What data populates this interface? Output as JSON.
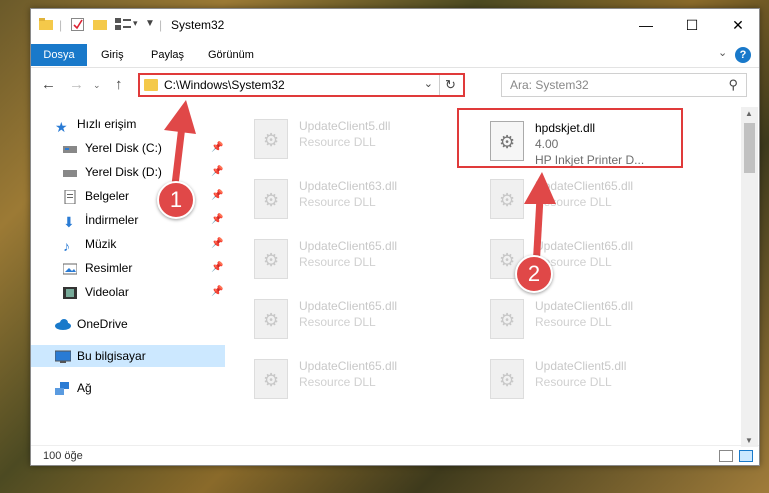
{
  "window": {
    "title": "System32",
    "minimize": "—",
    "maximize": "☐",
    "close": "✕"
  },
  "ribbon": {
    "tabs": [
      "Dosya",
      "Giriş",
      "Paylaş",
      "Görünüm"
    ],
    "help": "?"
  },
  "nav": {
    "address": "C:\\Windows\\System32",
    "search_placeholder": "Ara: System32"
  },
  "sidebar": {
    "items": [
      {
        "label": "Hızlı erişim",
        "icon": "star-icon"
      },
      {
        "label": "Yerel Disk (C:)",
        "icon": "drive-icon"
      },
      {
        "label": "Yerel Disk (D:)",
        "icon": "drive-icon"
      },
      {
        "label": "Belgeler",
        "icon": "documents-icon"
      },
      {
        "label": "İndirmeler",
        "icon": "download-icon"
      },
      {
        "label": "Müzik",
        "icon": "music-icon"
      },
      {
        "label": "Resimler",
        "icon": "pictures-icon"
      },
      {
        "label": "Videolar",
        "icon": "videos-icon"
      },
      {
        "label": "OneDrive",
        "icon": "cloud-icon"
      },
      {
        "label": "Bu bilgisayar",
        "icon": "computer-icon"
      },
      {
        "label": "Ağ",
        "icon": "network-icon"
      }
    ]
  },
  "files": {
    "left": [
      {
        "name": "UpdateClient5.dll",
        "type": "Resource DLL"
      },
      {
        "name": "UpdateClient63.dll",
        "type": "Resource DLL"
      },
      {
        "name": "UpdateClient65.dll",
        "type": "Resource DLL"
      },
      {
        "name": "UpdateClient65.dll",
        "type": "Resource DLL"
      },
      {
        "name": "UpdateClient65.dll",
        "type": "Resource DLL"
      }
    ],
    "right": [
      {
        "name": "hpdskjet.dll",
        "version": "4.00",
        "type": "HP Inkjet Printer D..."
      },
      {
        "name": "UpdateClient65.dll",
        "type": "Resource DLL"
      },
      {
        "name": "UpdateClient65.dll",
        "type": "Resource DLL"
      },
      {
        "name": "UpdateClient65.dll",
        "type": "Resource DLL"
      },
      {
        "name": "UpdateClient5.dll",
        "type": "Resource DLL"
      }
    ]
  },
  "status": {
    "count": "100 öğe"
  },
  "annotations": {
    "badge1": "1",
    "badge2": "2",
    "color": "#e04848"
  }
}
